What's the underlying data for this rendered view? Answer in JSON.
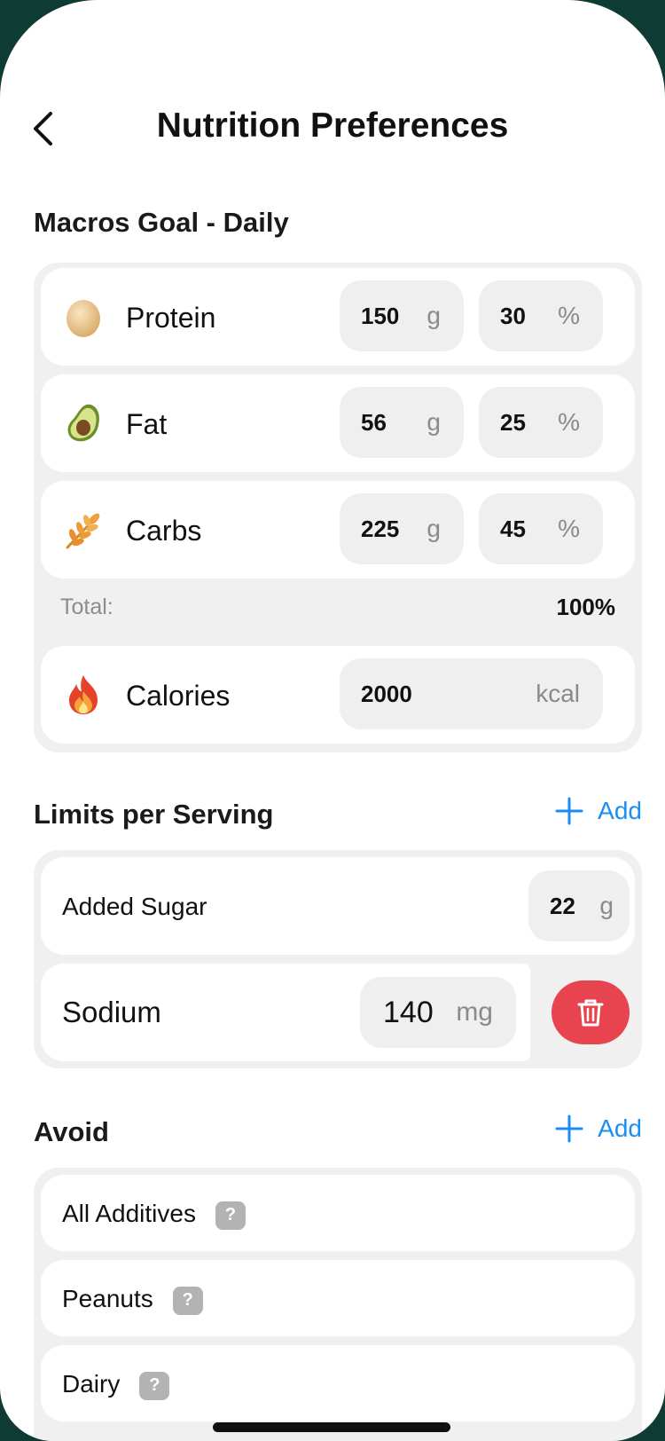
{
  "header": {
    "title": "Nutrition Preferences",
    "back_icon": "chevron-left-icon"
  },
  "macros": {
    "section_title": "Macros Goal - Daily",
    "items": [
      {
        "label": "Protein",
        "icon": "egg-icon",
        "grams": "150",
        "grams_unit": "g",
        "percent": "30",
        "percent_unit": "%"
      },
      {
        "label": "Fat",
        "icon": "avocado-icon",
        "grams": "56",
        "grams_unit": "g",
        "percent": "25",
        "percent_unit": "%"
      },
      {
        "label": "Carbs",
        "icon": "wheat-icon",
        "grams": "225",
        "grams_unit": "g",
        "percent": "45",
        "percent_unit": "%"
      }
    ],
    "total_label": "Total:",
    "total_value": "100%",
    "calories": {
      "label": "Calories",
      "icon": "fire-icon",
      "value": "2000",
      "unit": "kcal"
    }
  },
  "limits": {
    "section_title": "Limits per Serving",
    "add_label": "Add",
    "items": [
      {
        "label": "Added Sugar",
        "value": "22",
        "unit": "g"
      },
      {
        "label": "Sodium",
        "value": "140",
        "unit": "mg"
      }
    ]
  },
  "avoid": {
    "section_title": "Avoid",
    "add_label": "Add",
    "items": [
      {
        "label": "All Additives",
        "help": "?"
      },
      {
        "label": "Peanuts",
        "help": "?"
      },
      {
        "label": "Dairy",
        "help": "?"
      }
    ]
  },
  "colors": {
    "accent": "#1b8ef2",
    "danger": "#e8444f",
    "group_bg": "#f0f0f0",
    "frame_bg": "#0e3b34"
  }
}
